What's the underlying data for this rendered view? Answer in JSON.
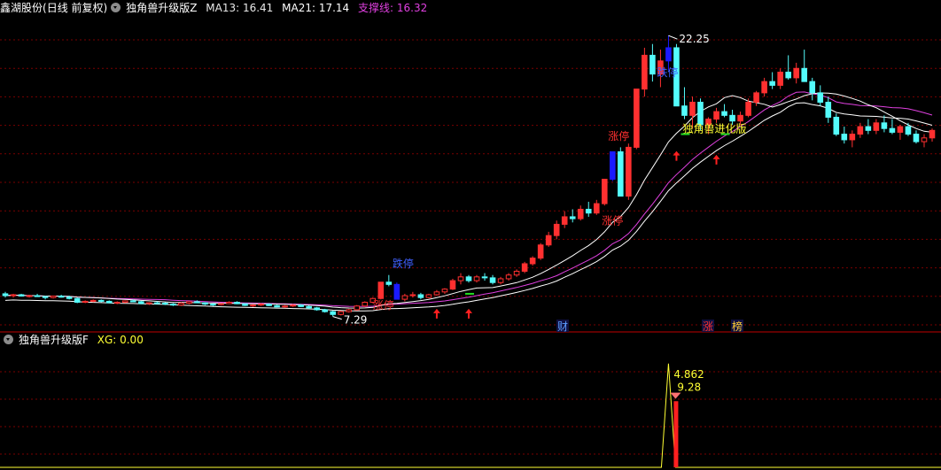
{
  "header_main": {
    "stock_name": "鑫湖股份",
    "period_label": "(日线 前复权)",
    "indicator_name": "独角兽升级版Z",
    "ma13_label": "MA13: 16.41",
    "ma21_label": "MA21: 17.14",
    "support_label": "支撑线: 16.32"
  },
  "header_sub": {
    "indicator_name": "独角兽升级版F",
    "xg_label": "XG: 0.00"
  },
  "colors": {
    "up": "#ff3030",
    "down": "#54fcfc",
    "limit_down_bar": "#1a1aff",
    "ma13": "#ffffff",
    "ma21": "#e040e0",
    "support": "#ffffff",
    "grid": "#7a0000",
    "yellow": "#ffff33",
    "label_blue": "#4060ff",
    "label_red": "#ff3030"
  },
  "chart_data": {
    "type": "candlestick",
    "ohlc": [
      [
        8.5,
        8.6,
        8.3,
        8.4
      ],
      [
        8.4,
        8.5,
        8.3,
        8.45
      ],
      [
        8.45,
        8.5,
        8.35,
        8.38
      ],
      [
        8.38,
        8.45,
        8.3,
        8.4
      ],
      [
        8.4,
        8.5,
        8.35,
        8.35
      ],
      [
        8.35,
        8.4,
        8.2,
        8.3
      ],
      [
        8.3,
        8.4,
        8.25,
        8.38
      ],
      [
        8.38,
        8.45,
        8.3,
        8.32
      ],
      [
        8.32,
        8.4,
        8.2,
        8.25
      ],
      [
        8.25,
        8.3,
        8.0,
        8.05
      ],
      [
        8.05,
        8.15,
        8.0,
        8.1
      ],
      [
        8.1,
        8.2,
        8.05,
        8.15
      ],
      [
        8.15,
        8.2,
        8.05,
        8.1
      ],
      [
        8.1,
        8.15,
        8.0,
        8.02
      ],
      [
        8.02,
        8.1,
        7.95,
        8.05
      ],
      [
        8.05,
        8.15,
        8.0,
        8.12
      ],
      [
        8.12,
        8.2,
        8.05,
        8.08
      ],
      [
        8.08,
        8.12,
        7.95,
        7.98
      ],
      [
        7.98,
        8.05,
        7.9,
        8.02
      ],
      [
        8.02,
        8.1,
        7.95,
        8.0
      ],
      [
        8.0,
        8.05,
        7.9,
        7.95
      ],
      [
        7.95,
        8.0,
        7.85,
        7.9
      ],
      [
        7.9,
        8.05,
        7.85,
        8.0
      ],
      [
        8.0,
        8.1,
        7.95,
        8.08
      ],
      [
        8.08,
        8.15,
        8.0,
        8.02
      ],
      [
        8.02,
        8.05,
        7.9,
        7.95
      ],
      [
        7.95,
        8.0,
        7.85,
        7.92
      ],
      [
        7.92,
        8.0,
        7.88,
        7.98
      ],
      [
        7.98,
        8.1,
        7.95,
        8.05
      ],
      [
        8.05,
        8.1,
        7.95,
        7.97
      ],
      [
        7.97,
        8.0,
        7.85,
        7.88
      ],
      [
        7.88,
        7.95,
        7.8,
        7.9
      ],
      [
        7.9,
        8.0,
        7.85,
        7.95
      ],
      [
        7.95,
        8.0,
        7.85,
        7.87
      ],
      [
        7.87,
        7.92,
        7.78,
        7.8
      ],
      [
        7.8,
        7.9,
        7.75,
        7.85
      ],
      [
        7.85,
        7.95,
        7.8,
        7.9
      ],
      [
        7.9,
        7.95,
        7.8,
        7.82
      ],
      [
        7.82,
        7.88,
        7.7,
        7.75
      ],
      [
        7.75,
        7.8,
        7.6,
        7.65
      ],
      [
        7.65,
        7.7,
        7.5,
        7.55
      ],
      [
        7.55,
        7.6,
        7.29,
        7.4
      ],
      [
        7.4,
        7.6,
        7.35,
        7.55
      ],
      [
        7.55,
        7.7,
        7.5,
        7.65
      ],
      [
        7.65,
        7.9,
        7.6,
        7.85
      ],
      [
        7.85,
        8.1,
        7.8,
        8.05
      ],
      [
        8.05,
        8.3,
        8.0,
        8.25
      ],
      [
        8.25,
        9.12,
        8.2,
        9.12
      ],
      [
        9.12,
        9.5,
        8.9,
        9.0
      ],
      [
        9.0,
        9.1,
        8.21,
        8.21
      ],
      [
        8.21,
        8.5,
        8.1,
        8.4
      ],
      [
        8.4,
        8.6,
        8.3,
        8.45
      ],
      [
        8.45,
        8.55,
        8.2,
        8.3
      ],
      [
        8.3,
        8.5,
        8.25,
        8.45
      ],
      [
        8.45,
        8.7,
        8.4,
        8.6
      ],
      [
        8.6,
        8.8,
        8.5,
        8.75
      ],
      [
        8.75,
        9.3,
        8.7,
        9.2
      ],
      [
        9.2,
        9.6,
        9.0,
        9.4
      ],
      [
        9.4,
        9.5,
        9.1,
        9.2
      ],
      [
        9.2,
        9.5,
        9.1,
        9.4
      ],
      [
        9.4,
        9.6,
        9.2,
        9.35
      ],
      [
        9.35,
        9.5,
        9.0,
        9.1
      ],
      [
        9.1,
        9.4,
        9.0,
        9.3
      ],
      [
        9.3,
        9.6,
        9.2,
        9.5
      ],
      [
        9.5,
        9.8,
        9.4,
        9.7
      ],
      [
        9.7,
        10.2,
        9.6,
        10.1
      ],
      [
        10.1,
        10.5,
        10.0,
        10.4
      ],
      [
        10.4,
        11.2,
        10.3,
        11.1
      ],
      [
        11.1,
        11.8,
        11.0,
        11.6
      ],
      [
        11.6,
        12.4,
        11.4,
        12.2
      ],
      [
        12.2,
        12.9,
        12.0,
        12.6
      ],
      [
        12.6,
        13.0,
        12.3,
        12.5
      ],
      [
        12.5,
        13.2,
        12.4,
        13.0
      ],
      [
        13.0,
        13.4,
        12.6,
        12.8
      ],
      [
        12.8,
        13.5,
        12.7,
        13.3
      ],
      [
        13.3,
        14.6,
        13.2,
        14.6
      ],
      [
        14.6,
        16.06,
        14.5,
        16.06
      ],
      [
        16.06,
        16.3,
        13.7,
        13.7
      ],
      [
        13.7,
        16.5,
        13.5,
        16.3
      ],
      [
        16.3,
        19.4,
        16.2,
        19.4
      ],
      [
        19.4,
        21.6,
        19.0,
        21.2
      ],
      [
        21.2,
        21.8,
        19.8,
        20.2
      ],
      [
        20.2,
        21.5,
        19.5,
        20.9
      ],
      [
        20.9,
        22.25,
        20.4,
        21.6
      ],
      [
        21.6,
        21.8,
        18.5,
        18.5
      ],
      [
        18.5,
        19.5,
        17.8,
        18.0
      ],
      [
        18.0,
        19.0,
        17.3,
        18.7
      ],
      [
        18.7,
        18.9,
        17.2,
        17.5
      ],
      [
        17.5,
        17.9,
        17.0,
        17.8
      ],
      [
        17.8,
        18.4,
        17.6,
        18.2
      ],
      [
        18.2,
        18.6,
        17.9,
        18.0
      ],
      [
        18.0,
        18.3,
        17.5,
        17.7
      ],
      [
        17.7,
        18.2,
        17.5,
        18.0
      ],
      [
        18.0,
        18.9,
        17.9,
        18.7
      ],
      [
        18.7,
        19.3,
        18.5,
        19.2
      ],
      [
        19.2,
        20.0,
        19.0,
        19.8
      ],
      [
        19.8,
        20.3,
        19.4,
        19.6
      ],
      [
        19.6,
        20.5,
        19.4,
        20.3
      ],
      [
        20.3,
        21.2,
        19.9,
        20.0
      ],
      [
        20.0,
        20.8,
        19.7,
        20.5
      ],
      [
        20.5,
        21.5,
        20.3,
        19.8
      ],
      [
        19.8,
        20.0,
        18.8,
        19.2
      ],
      [
        19.2,
        19.6,
        18.5,
        18.7
      ],
      [
        18.7,
        19.0,
        17.6,
        17.9
      ],
      [
        17.9,
        18.1,
        16.9,
        17.0
      ],
      [
        17.0,
        17.4,
        16.5,
        16.7
      ],
      [
        16.7,
        17.2,
        16.3,
        17.0
      ],
      [
        17.0,
        17.6,
        16.8,
        17.4
      ],
      [
        17.4,
        17.8,
        17.0,
        17.2
      ],
      [
        17.2,
        17.8,
        17.0,
        17.6
      ],
      [
        17.6,
        18.0,
        17.1,
        17.3
      ],
      [
        17.3,
        17.8,
        17.0,
        17.1
      ],
      [
        17.1,
        17.5,
        16.7,
        17.4
      ],
      [
        17.4,
        17.6,
        16.9,
        17.0
      ],
      [
        17.0,
        17.2,
        16.5,
        16.6
      ],
      [
        16.6,
        17.0,
        16.3,
        16.8
      ],
      [
        16.8,
        17.3,
        16.6,
        17.2
      ]
    ],
    "y_high_label": "22.25",
    "y_low_label": "7.29",
    "annotations": {
      "dt1": "跌停",
      "zt1": "涨停",
      "dt2": "跌停",
      "zt2": "涨停",
      "zt3": "涨停",
      "dt3": "跌停",
      "jh": "独角兽进化版"
    },
    "event_badges": {
      "cai": "财",
      "zhang": "涨",
      "bang": "榜"
    },
    "sub": {
      "peak_label": "4.862",
      "marker_label": "9.28",
      "peak_value": 4.862,
      "bar_value": 3.1,
      "y_max": 5.6
    }
  }
}
